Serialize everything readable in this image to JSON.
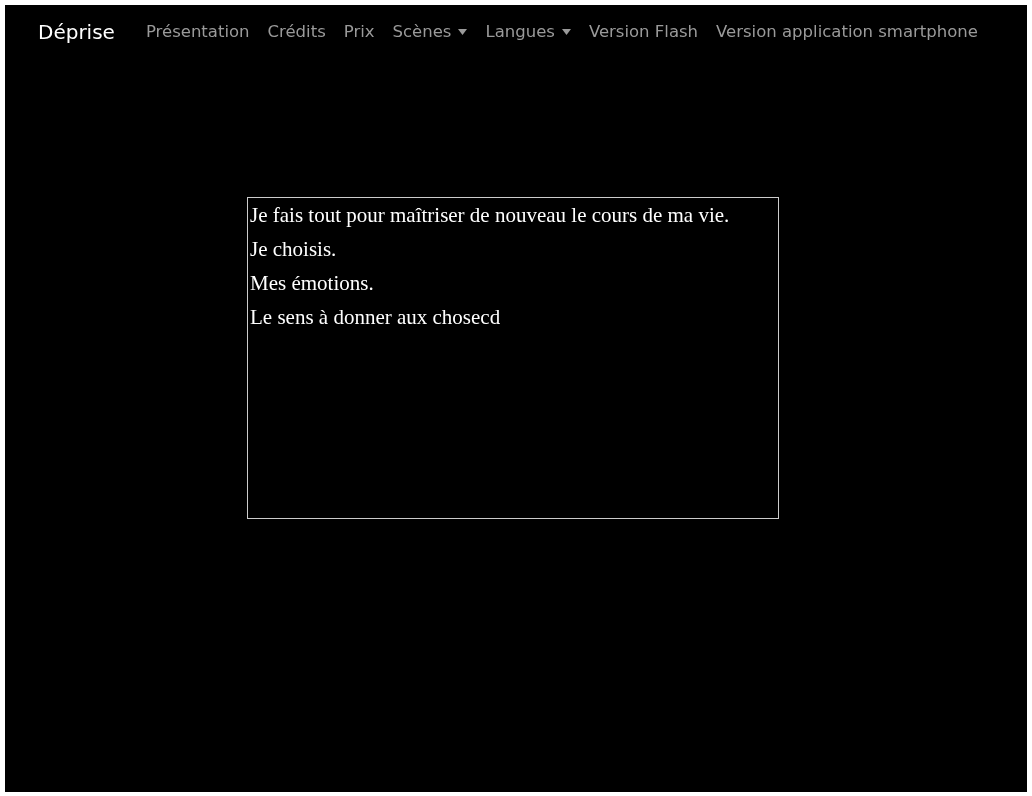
{
  "navbar": {
    "brand": "Déprise",
    "items": [
      {
        "label": "Présentation",
        "kind": "link"
      },
      {
        "label": "Crédits",
        "kind": "link"
      },
      {
        "label": "Prix",
        "kind": "link"
      },
      {
        "label": "Scènes",
        "kind": "dropdown"
      },
      {
        "label": "Langues",
        "kind": "dropdown"
      },
      {
        "label": "Version Flash",
        "kind": "link"
      },
      {
        "label": "Version application smartphone",
        "kind": "link"
      }
    ]
  },
  "text_box": {
    "lines": [
      "Je fais tout pour maîtriser de nouveau le cours de ma vie.",
      "Je choisis.",
      "Mes émotions.",
      "Le sens à donner aux chosecd"
    ]
  }
}
